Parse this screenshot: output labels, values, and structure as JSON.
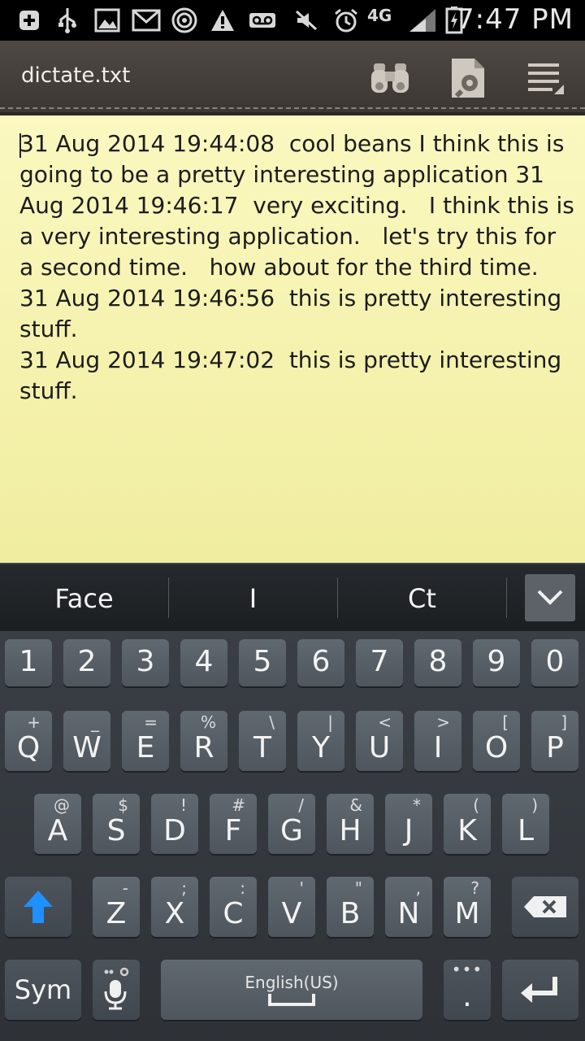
{
  "status_bar": {
    "time": "7:47 PM",
    "network": "4G",
    "icons": [
      "add-icon",
      "usb-icon",
      "gallery-icon",
      "gmail-icon",
      "nfc-icon",
      "warning-icon",
      "voicemail-icon",
      "mute-icon",
      "alarm-icon",
      "network-4g-icon",
      "signal-icon",
      "battery-charging-icon"
    ]
  },
  "title_bar": {
    "filename": "dictate.txt",
    "icons": [
      "binoculars-icon",
      "document-settings-icon",
      "menu-icon"
    ]
  },
  "note": {
    "text": "31 Aug 2014 19:44:08  cool beans I think this is going to be a pretty interesting application 31 Aug 2014 19:46:17  very exciting.   I think this is a very interesting application.   let's try this for a second time.   how about for the third time.\n31 Aug 2014 19:46:56  this is pretty interesting stuff.\n31 Aug 2014 19:47:02  this is pretty interesting stuff."
  },
  "suggestions": [
    "Face",
    "I",
    "Ct"
  ],
  "keyboard": {
    "numbers": [
      "1",
      "2",
      "3",
      "4",
      "5",
      "6",
      "7",
      "8",
      "9",
      "0"
    ],
    "row1": [
      {
        "main": "Q",
        "sub": "+"
      },
      {
        "main": "W",
        "sub": "_"
      },
      {
        "main": "E",
        "sub": "="
      },
      {
        "main": "R",
        "sub": "%"
      },
      {
        "main": "T",
        "sub": "\\"
      },
      {
        "main": "Y",
        "sub": "|"
      },
      {
        "main": "U",
        "sub": "<"
      },
      {
        "main": "I",
        "sub": ">"
      },
      {
        "main": "O",
        "sub": "["
      },
      {
        "main": "P",
        "sub": "]"
      }
    ],
    "row2": [
      {
        "main": "A",
        "sub": "@"
      },
      {
        "main": "S",
        "sub": "$"
      },
      {
        "main": "D",
        "sub": "!"
      },
      {
        "main": "F",
        "sub": "#"
      },
      {
        "main": "G",
        "sub": "/"
      },
      {
        "main": "H",
        "sub": "&"
      },
      {
        "main": "J",
        "sub": "*"
      },
      {
        "main": "K",
        "sub": "("
      },
      {
        "main": "L",
        "sub": ")"
      }
    ],
    "row3": [
      {
        "main": "Z",
        "sub": "-"
      },
      {
        "main": "X",
        "sub": ";"
      },
      {
        "main": "C",
        "sub": ":"
      },
      {
        "main": "V",
        "sub": "'"
      },
      {
        "main": "B",
        "sub": "\""
      },
      {
        "main": "N",
        "sub": ","
      },
      {
        "main": "M",
        "sub": "?"
      }
    ],
    "sym_label": "Sym",
    "space_label": "English(US)",
    "period_label": "."
  }
}
